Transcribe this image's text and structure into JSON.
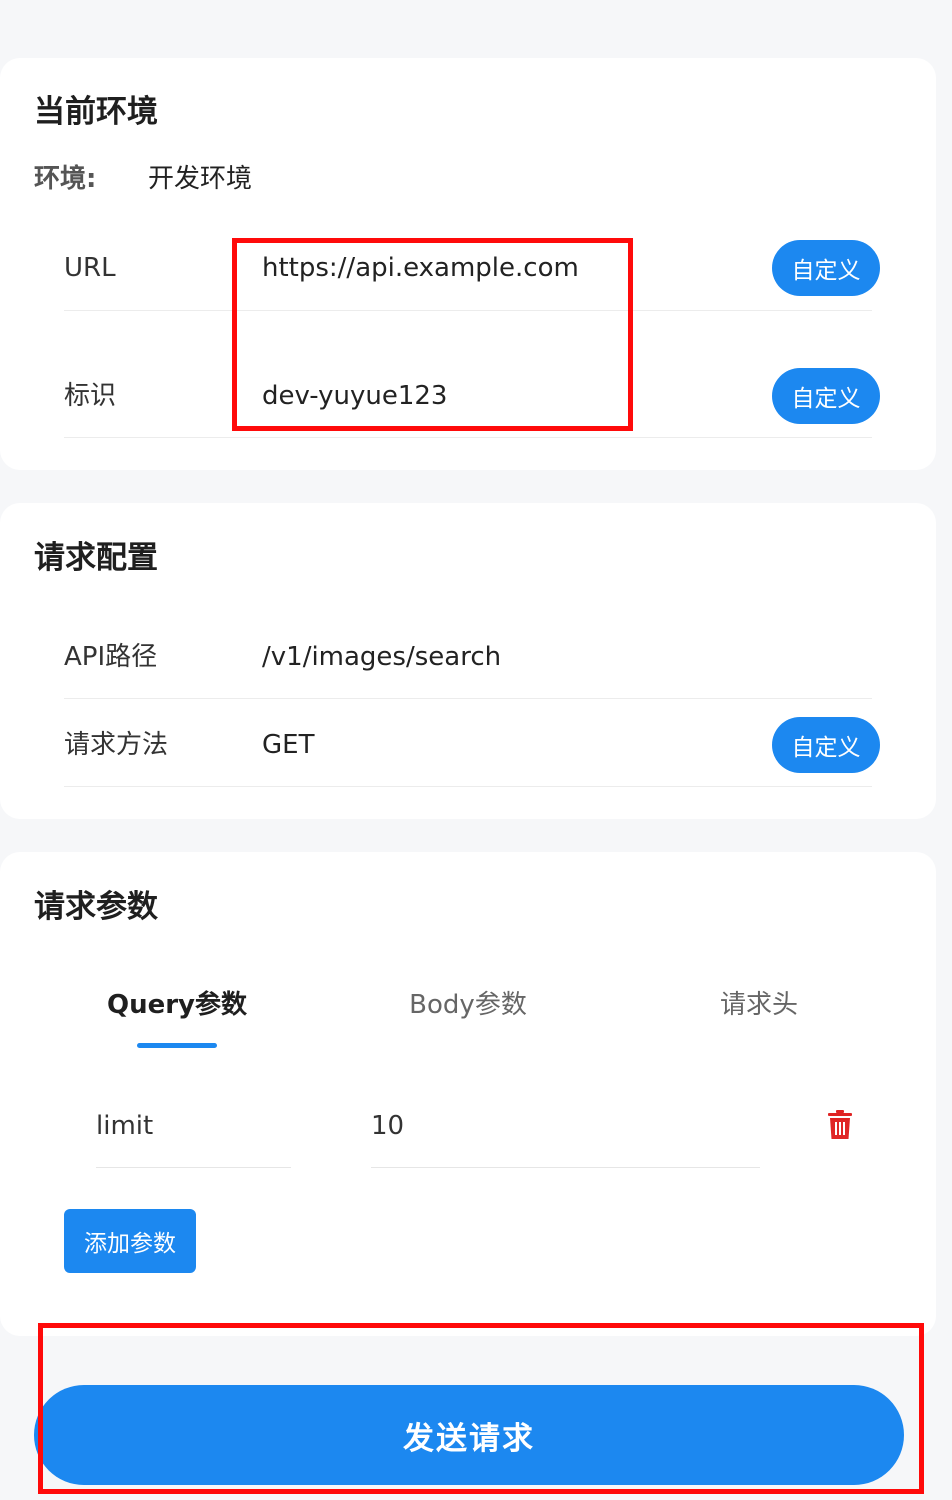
{
  "environment_card": {
    "title": "当前环境",
    "env_label": "环境:",
    "env_value": "开发环境",
    "rows": [
      {
        "label": "URL",
        "value": "https://api.example.com",
        "button": "自定义"
      },
      {
        "label": "标识",
        "value": "dev-yuyue123",
        "button": "自定义"
      }
    ]
  },
  "request_config_card": {
    "title": "请求配置",
    "rows": [
      {
        "label": "API路径",
        "value": "/v1/images/search"
      },
      {
        "label": "请求方法",
        "value": "GET",
        "button": "自定义"
      }
    ]
  },
  "request_params_card": {
    "title": "请求参数",
    "tabs": [
      {
        "label": "Query参数",
        "active": true
      },
      {
        "label": "Body参数",
        "active": false
      },
      {
        "label": "请求头",
        "active": false
      }
    ],
    "params": [
      {
        "key": "limit",
        "value": "10"
      }
    ],
    "add_button": "添加参数"
  },
  "send_button": "发送请求",
  "colors": {
    "accent": "#1c88f0",
    "danger": "#e02424",
    "highlight": "#ff0a0a",
    "background": "#f6f7f9"
  },
  "icons": {
    "delete": "trash-icon"
  }
}
